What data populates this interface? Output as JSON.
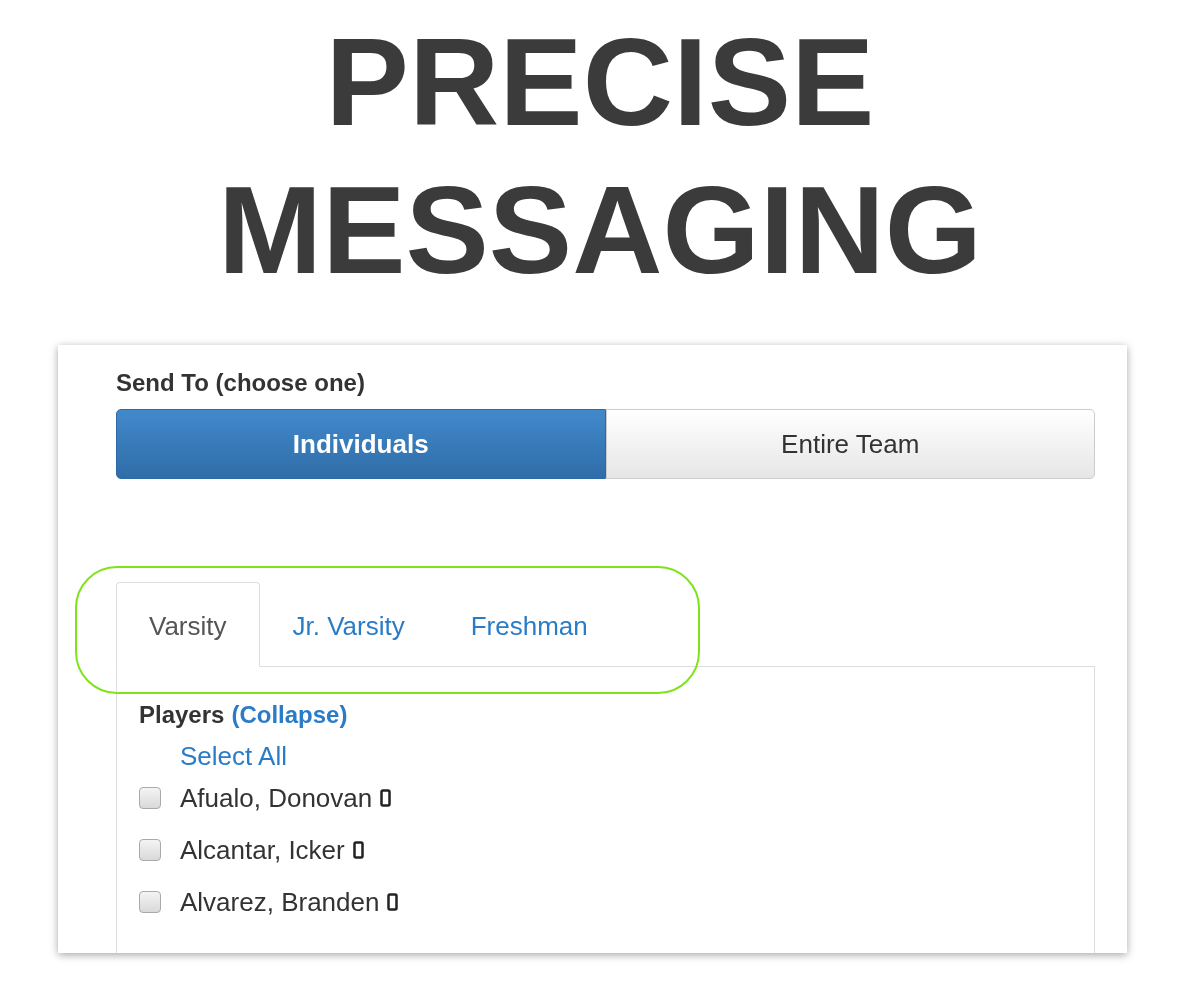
{
  "headline": [
    "PRECISE",
    "MESSAGING"
  ],
  "send_to": {
    "label": "Send To (choose one)",
    "options": [
      {
        "label": "Individuals",
        "selected": true
      },
      {
        "label": "Entire Team",
        "selected": false
      }
    ]
  },
  "tabs_highlighted": true,
  "tabs": [
    {
      "label": "Varsity",
      "selected": true
    },
    {
      "label": "Jr. Varsity",
      "selected": false
    },
    {
      "label": "Freshman",
      "selected": false
    }
  ],
  "players": {
    "title": "Players",
    "toggle": "(Collapse)",
    "select_all": "Select All",
    "items": [
      {
        "name": "Afualo, Donovan",
        "checked": false,
        "has_phone": true
      },
      {
        "name": "Alcantar, Icker",
        "checked": false,
        "has_phone": true
      },
      {
        "name": "Alvarez, Branden",
        "checked": false,
        "has_phone": true
      }
    ]
  }
}
